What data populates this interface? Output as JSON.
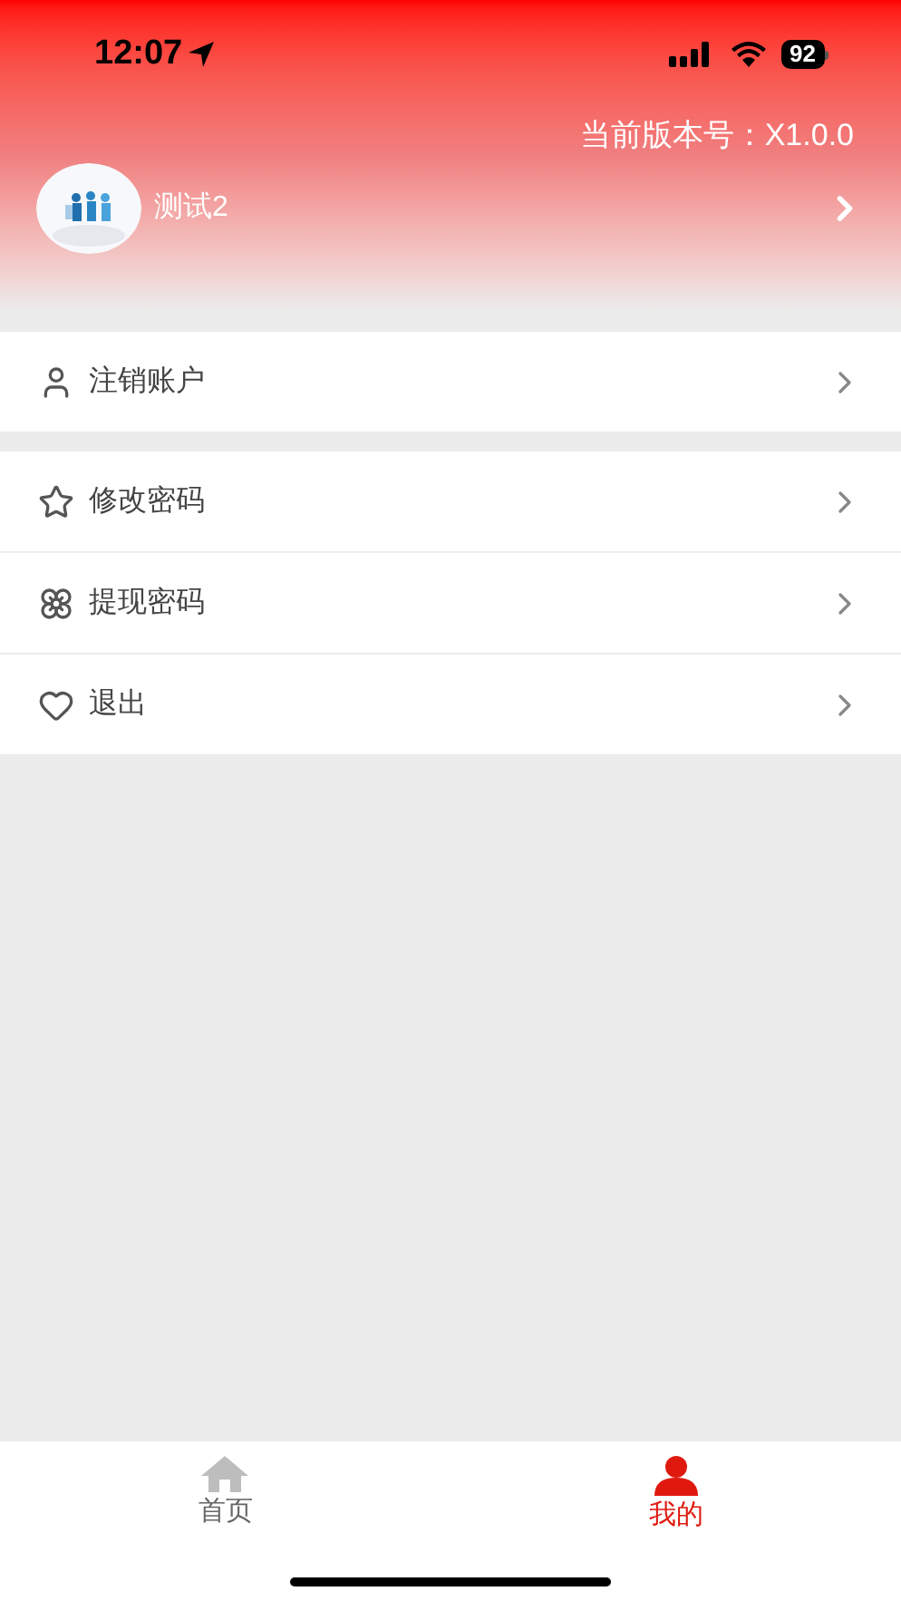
{
  "status_bar": {
    "time": "12:07",
    "battery": "92"
  },
  "profile": {
    "version": "当前版本号：X1.0.0",
    "name": "测试2"
  },
  "menu_groups": [
    {
      "items": [
        {
          "kind": "person",
          "label": "注销账户"
        }
      ]
    },
    {
      "items": [
        {
          "kind": "star",
          "label": "修改密码"
        },
        {
          "kind": "flower",
          "label": "提现密码"
        },
        {
          "kind": "heart",
          "label": "退出"
        }
      ]
    }
  ],
  "tab_bar": [
    {
      "kind": "home",
      "label": "首页",
      "selected": false
    },
    {
      "kind": "person",
      "label": "我的",
      "selected": true
    }
  ]
}
